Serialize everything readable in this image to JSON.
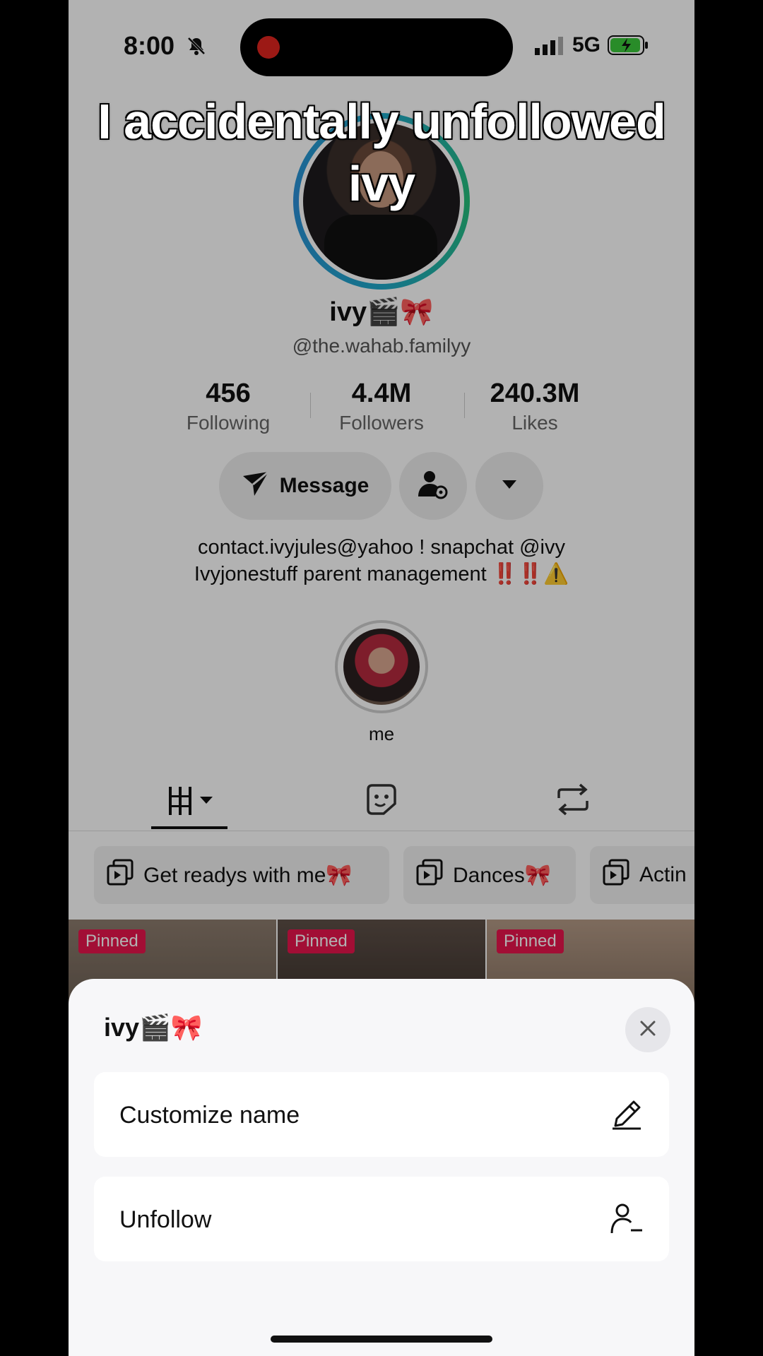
{
  "status_bar": {
    "time": "8:00",
    "network": "5G"
  },
  "caption": "I accidentally unfollowed ivy",
  "profile": {
    "display_name": "ivy🎬🎀",
    "handle": "@the.wahab.familyy",
    "stats": [
      {
        "value": "456",
        "label": "Following"
      },
      {
        "value": "4.4M",
        "label": "Followers"
      },
      {
        "value": "240.3M",
        "label": "Likes"
      }
    ],
    "message_label": "Message",
    "bio_line1": "contact.ivyjules@yahoo ! snapchat @ivy",
    "bio_line2_text": "Ivyjonestuff parent management",
    "bio_line2_emoji": "‼️‼️⚠️",
    "highlight_label": "me"
  },
  "playlists": [
    {
      "label": "Get readys with me🎀"
    },
    {
      "label": "Dances🎀"
    },
    {
      "label": "Actin"
    }
  ],
  "videos": [
    {
      "badge": "Pinned"
    },
    {
      "badge": "Pinned"
    },
    {
      "badge": "Pinned"
    }
  ],
  "sheet": {
    "title": "ivy🎬🎀",
    "options": [
      {
        "label": "Customize name",
        "icon": "pencil-icon"
      },
      {
        "label": "Unfollow",
        "icon": "remove-user-icon"
      }
    ]
  },
  "colors": {
    "pinned": "#e8154d",
    "ring": "#1fa8c9",
    "recording": "#e0251f"
  }
}
